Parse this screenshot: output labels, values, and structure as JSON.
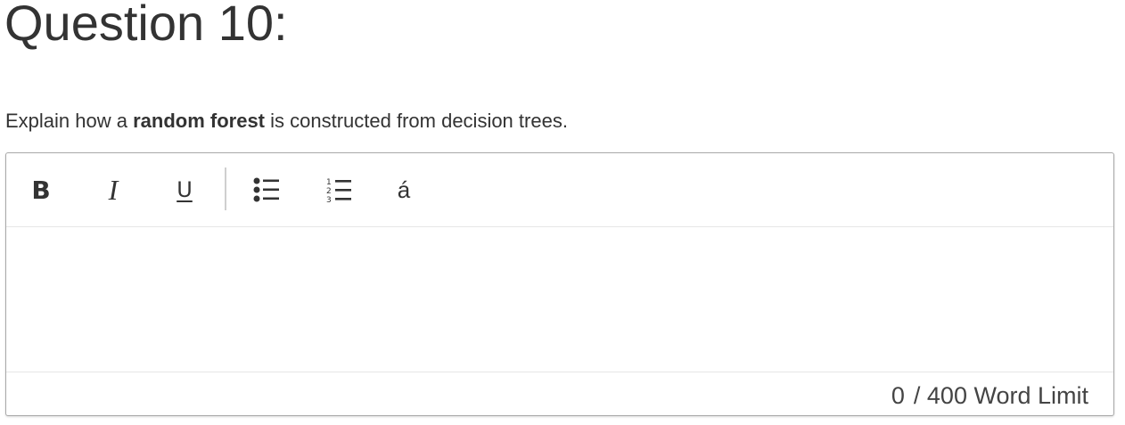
{
  "question": {
    "title": "Question 10:",
    "prompt_before": "Explain how a ",
    "prompt_bold": "random forest",
    "prompt_after": " is constructed from decision trees."
  },
  "toolbar": {
    "bold_label": "B",
    "italic_label": "I",
    "underline_label": "U",
    "bullets_icon": "bulleted-list-icon",
    "numbers_icon": "numbered-list-icon",
    "special_chars_label": "á"
  },
  "editor": {
    "content": ""
  },
  "footer": {
    "word_count": "0",
    "word_limit_text": "/ 400 Word Limit"
  }
}
